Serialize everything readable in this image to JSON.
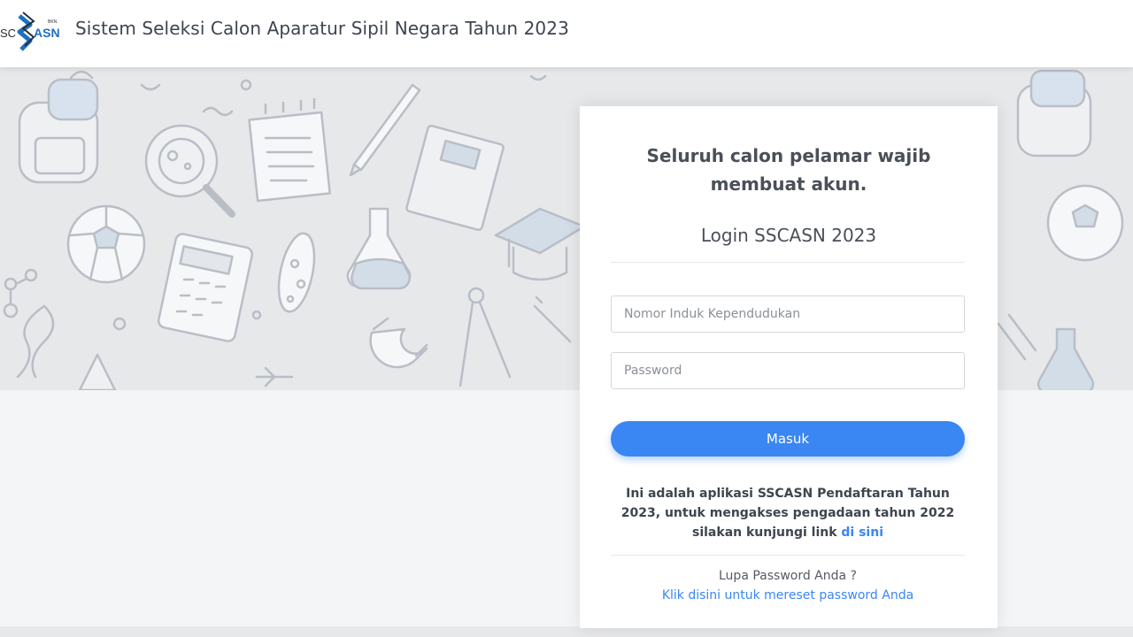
{
  "header": {
    "logo_text": "SSCASN",
    "title": "Sistem Seleksi Calon Aparatur Sipil Negara Tahun 2023"
  },
  "login_card": {
    "notice": "Seluruh calon pelamar wajib membuat akun.",
    "title": "Login SSCASN 2023",
    "nik_placeholder": "Nomor Induk Kependudukan",
    "password_placeholder": "Password",
    "submit_label": "Masuk",
    "info_text_1": "Ini adalah aplikasi SSCASN Pendaftaran Tahun 2023, untuk mengakses pengadaan tahun 2022 silakan kunjungi link ",
    "info_link": "di sini",
    "forgot_text": "Lupa Password Anda ?",
    "reset_link": "Klik disini untuk mereset password Anda"
  },
  "colors": {
    "accent": "#3a86f2",
    "logo_blue": "#1d6fc2",
    "text_dark": "#3d4550",
    "hero_bg": "#e7e8ea"
  },
  "background_icons": [
    "backpack-icon",
    "magnifier-icon",
    "notepad-icon",
    "pen-icon",
    "book-icon",
    "ball-icon",
    "calculator-icon",
    "flask-icon",
    "graduation-cap-icon",
    "compass-icon",
    "magnet-icon",
    "dna-icon"
  ]
}
